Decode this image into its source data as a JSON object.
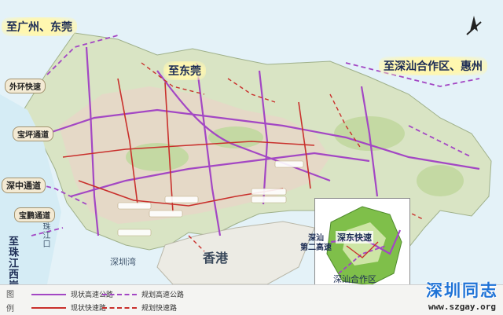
{
  "map": {
    "destinations": {
      "guangzhou": "至广州、东莞",
      "dongguan": "至东莞",
      "shenshan": "至深汕合作区、惠州",
      "zhuhai": "至珠江西岸"
    },
    "corridors": {
      "waihuan": "外环快速",
      "baoping": "宝坪通道",
      "shenzhong": "深中通道",
      "baopeng": "宝鹏通道",
      "zhujiangkou": "珠江口"
    },
    "places": {
      "hongkong": "香港",
      "shenzhen_bay": "深圳湾"
    },
    "inset": {
      "shendong": "深东快速",
      "shenshan_second": "深汕\n第二高速",
      "shenshan_zone": "深汕合作区"
    }
  },
  "legend": {
    "heading_top": "图",
    "heading_bottom": "例",
    "items": [
      {
        "label": "现状高速公路",
        "color": "#a347c4",
        "style": "solid"
      },
      {
        "label": "规划高速公路",
        "color": "#a347c4",
        "style": "dashed"
      },
      {
        "label": "现状快速路",
        "color": "#c9302c",
        "style": "solid"
      },
      {
        "label": "规划快速路",
        "color": "#c9302c",
        "style": "dashed"
      }
    ]
  },
  "watermark": {
    "title": "深圳同志",
    "url": "www.szgay.org"
  }
}
